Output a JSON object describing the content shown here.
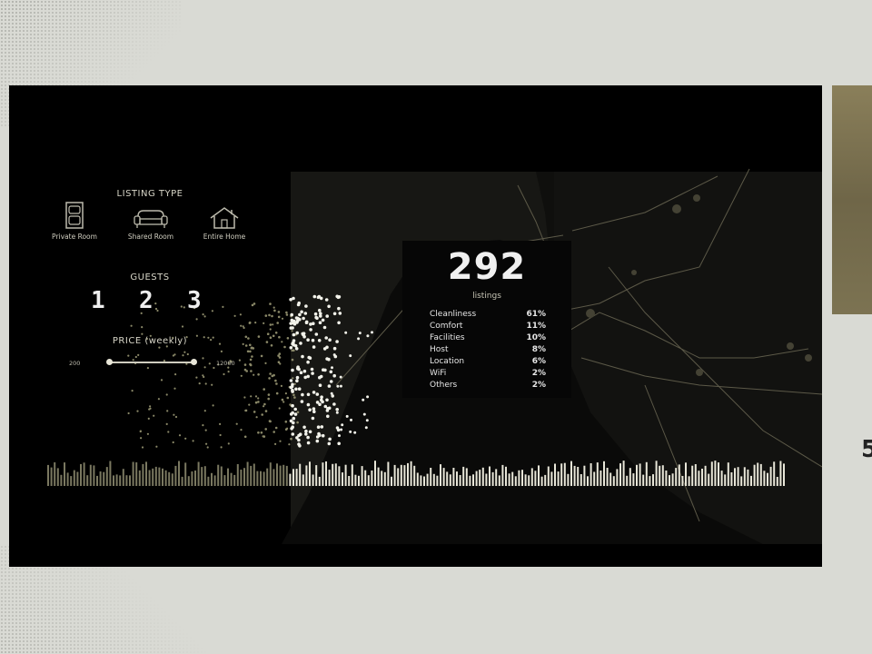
{
  "listing_type": {
    "title": "LISTING TYPE",
    "options": [
      {
        "label": "Private Room",
        "icon": "private-room-icon"
      },
      {
        "label": "Shared Room",
        "icon": "sofa-icon"
      },
      {
        "label": "Entire Home",
        "icon": "house-icon"
      }
    ]
  },
  "guests": {
    "title": "GUESTS",
    "options": [
      "1",
      "2",
      "3"
    ]
  },
  "price": {
    "title": "PRICE (weekly)",
    "min_label": "200",
    "max_label": "12000",
    "selected_fraction": [
      0.0,
      1.0
    ]
  },
  "stats": {
    "count": "292",
    "count_label": "listings",
    "categories": [
      {
        "name": "Cleanliness",
        "value": "61%"
      },
      {
        "name": "Comfort",
        "value": "11%"
      },
      {
        "name": "Facilities",
        "value": "10%"
      },
      {
        "name": "Host",
        "value": "8%"
      },
      {
        "name": "Location",
        "value": "6%"
      },
      {
        "name": "WiFi",
        "value": "2%"
      },
      {
        "name": "Others",
        "value": "2%"
      }
    ]
  },
  "colors": {
    "background": "#000000",
    "point_bright": "#f2f2ea",
    "point_dim": "#8a8868",
    "map_line": "#6e6a55",
    "text": "#d8d6c8"
  }
}
